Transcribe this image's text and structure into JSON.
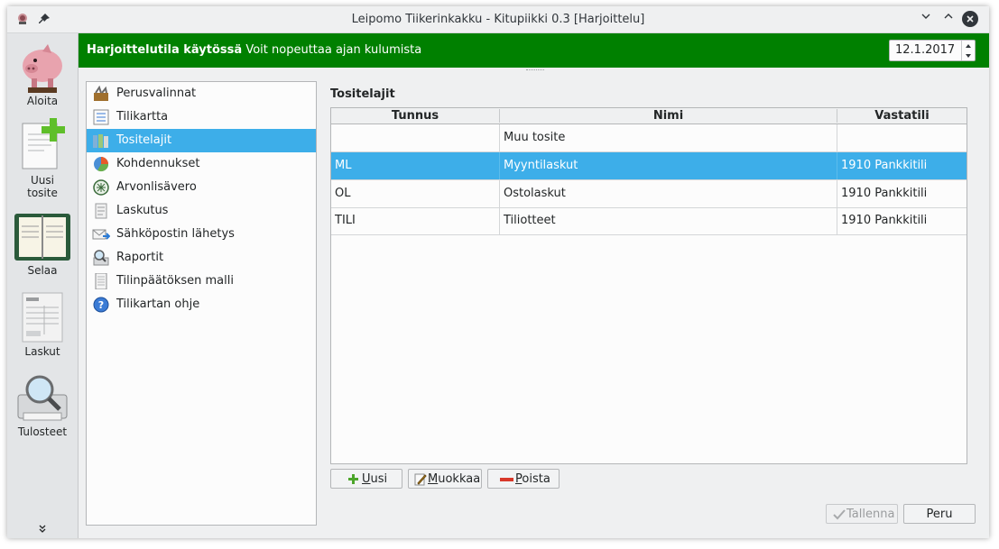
{
  "window": {
    "title": "Leipomo Tiikerinkakku - Kitupiikki 0.3 [Harjoittelu]"
  },
  "sidebar": {
    "items": [
      {
        "label": "Aloita",
        "icon": "piggy-bank-icon"
      },
      {
        "label_line1": "Uusi",
        "label_line2": "tosite",
        "icon": "new-document-icon"
      },
      {
        "label": "Selaa",
        "icon": "ledger-book-icon"
      },
      {
        "label": "Laskut",
        "icon": "invoice-icon"
      },
      {
        "label": "Tulosteet",
        "icon": "printer-magnifier-icon"
      }
    ],
    "more": "»"
  },
  "banner": {
    "bold": "Harjoittelutila käytössä",
    "text": "Voit nopeuttaa ajan kulumista",
    "date": "12.1.2017",
    "color": "#008000"
  },
  "nav": {
    "items": [
      {
        "label": "Perusvalinnat",
        "icon": "tools-icon"
      },
      {
        "label": "Tilikartta",
        "icon": "list-icon"
      },
      {
        "label": "Tositelajit",
        "icon": "folders-icon",
        "selected": true
      },
      {
        "label": "Kohdennukset",
        "icon": "pie-chart-icon"
      },
      {
        "label": "Arvonlisävero",
        "icon": "tax-seal-icon"
      },
      {
        "label": "Laskutus",
        "icon": "document-icon"
      },
      {
        "label": "Sähköpostin lähetys",
        "icon": "email-send-icon"
      },
      {
        "label": "Raportit",
        "icon": "report-icon"
      },
      {
        "label": "Tilinpäätöksen malli",
        "icon": "page-icon"
      },
      {
        "label": "Tilikartan ohje",
        "icon": "help-icon"
      }
    ]
  },
  "main": {
    "title": "Tositelajit",
    "columns": [
      "Tunnus",
      "Nimi",
      "Vastatili"
    ],
    "rows": [
      {
        "tunnus": "",
        "nimi": "Muu tosite",
        "vastatili": ""
      },
      {
        "tunnus": "ML",
        "nimi": "Myyntilaskut",
        "vastatili": "1910 Pankkitili",
        "selected": true
      },
      {
        "tunnus": "OL",
        "nimi": "Ostolaskut",
        "vastatili": "1910 Pankkitili"
      },
      {
        "tunnus": "TILI",
        "nimi": "Tiliotteet",
        "vastatili": "1910 Pankkitili"
      }
    ],
    "buttons": {
      "add": {
        "prefix": "",
        "accel": "U",
        "rest": "usi"
      },
      "edit": {
        "accel": "M",
        "rest": "uokkaa"
      },
      "delete": {
        "accel": "P",
        "rest": "oista"
      }
    }
  },
  "footer": {
    "save": "Tallenna",
    "cancel": "Peru"
  },
  "colors": {
    "selection": "#3daee9",
    "banner": "#008000"
  }
}
